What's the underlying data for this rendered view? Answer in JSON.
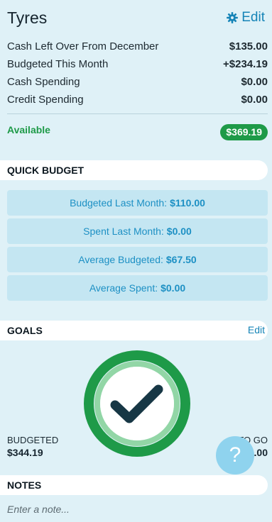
{
  "header": {
    "title": "Tyres",
    "edit_label": "Edit"
  },
  "summary": [
    {
      "label": "Cash Left Over From December",
      "value": "$135.00"
    },
    {
      "label": "Budgeted This Month",
      "value": "+$234.19"
    },
    {
      "label": "Cash Spending",
      "value": "$0.00"
    },
    {
      "label": "Credit Spending",
      "value": "$0.00"
    }
  ],
  "available": {
    "label": "Available",
    "value": "$369.19"
  },
  "quick_budget": {
    "title": "QUICK BUDGET",
    "items": [
      {
        "label": "Budgeted Last Month:",
        "value": "$110.00"
      },
      {
        "label": "Spent Last Month:",
        "value": "$0.00"
      },
      {
        "label": "Average Budgeted:",
        "value": "$67.50"
      },
      {
        "label": "Average Spent:",
        "value": "$0.00"
      }
    ]
  },
  "goals": {
    "title": "GOALS",
    "edit_label": "Edit",
    "budgeted_label": "BUDGETED",
    "budgeted_value": "$344.19",
    "to_go_label": "TO GO",
    "to_go_value": "$0.00",
    "progress": 1.0,
    "icon": "check-icon"
  },
  "notes": {
    "title": "NOTES",
    "placeholder": "Enter a note..."
  },
  "help": {
    "icon": "question-icon",
    "glyph": "?"
  },
  "colors": {
    "background": "#dff1f7",
    "accent": "#1584b7",
    "green": "#1e9a48",
    "quick_budget_bg": "#c4e6f2",
    "help_bg": "#8fd3ee"
  }
}
